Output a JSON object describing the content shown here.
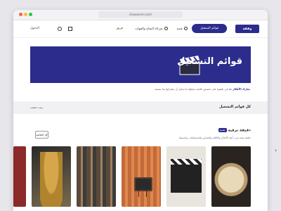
{
  "browser": {
    "url": "stuwoonm.com/"
  },
  "header": {
    "logo_text": "وقفة",
    "cta_label": "قوائم التشغيل",
    "nav_links": [
      "فصة",
      "شركاء النجاح والجهات",
      "فريق"
    ],
    "login_label": "الدخول"
  },
  "banner": {
    "title": "قوائم التشغيل"
  },
  "description": {
    "text": "هنا في تلقفوا على تنصيص قائمة تجعلها ما تحتاج أن تشاركها بما نصنعه.",
    "link": "شارك الأفكار"
  },
  "list_header": {
    "title": "كل قوائم التشغيل",
    "sort_label": "رتب حسب"
  },
  "section": {
    "title": "دقيقة ترفيه",
    "badge": "جديد",
    "description": "دقيقة ومنه غرب أهم الأماكن والأفلام والصانين والمسلسلات والسينما",
    "all_button": "كل القائمة"
  },
  "colors": {
    "brand": "#2c2c8c"
  }
}
